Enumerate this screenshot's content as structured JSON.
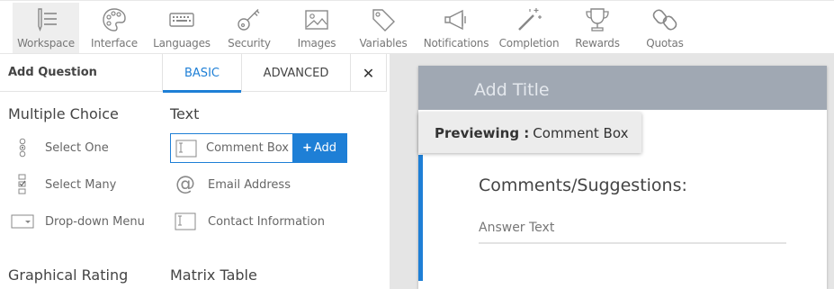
{
  "toolbar": {
    "items": [
      {
        "label": "Workspace",
        "icon": "workspace-icon",
        "active": true
      },
      {
        "label": "Interface",
        "icon": "palette-icon",
        "active": false
      },
      {
        "label": "Languages",
        "icon": "keyboard-icon",
        "active": false
      },
      {
        "label": "Security",
        "icon": "key-icon",
        "active": false
      },
      {
        "label": "Images",
        "icon": "image-icon",
        "active": false
      },
      {
        "label": "Variables",
        "icon": "tag-icon",
        "active": false
      },
      {
        "label": "Notifications",
        "icon": "megaphone-icon",
        "active": false
      },
      {
        "label": "Completion",
        "icon": "magic-wand-icon",
        "active": false
      },
      {
        "label": "Rewards",
        "icon": "trophy-icon",
        "active": false
      },
      {
        "label": "Quotas",
        "icon": "link-icon",
        "active": false
      }
    ]
  },
  "panel": {
    "title": "Add Question",
    "tabs": {
      "basic": "BASIC",
      "advanced": "ADVANCED"
    },
    "close_icon": "close-icon"
  },
  "sections": {
    "multiple_choice": {
      "title": "Multiple Choice",
      "items": [
        {
          "label": "Select One",
          "icon": "radio-list-icon"
        },
        {
          "label": "Select Many",
          "icon": "checkbox-list-icon"
        },
        {
          "label": "Drop-down Menu",
          "icon": "dropdown-icon"
        }
      ]
    },
    "text": {
      "title": "Text",
      "items": [
        {
          "label": "Comment Box",
          "icon": "text-box-icon"
        },
        {
          "label": "Email Address",
          "icon": "at-icon"
        },
        {
          "label": "Contact Information",
          "icon": "text-box-icon"
        }
      ],
      "add_button": "Add"
    },
    "graphical_rating": {
      "title": "Graphical Rating"
    },
    "matrix_table": {
      "title": "Matrix Table"
    }
  },
  "preview": {
    "add_title": "Add Title",
    "badge_key": "Previewing :",
    "badge_value": "Comment Box",
    "question": "Comments/Suggestions:",
    "answer_placeholder": "Answer Text"
  },
  "colors": {
    "accent": "#1e7fd6",
    "header": "#a0a8b3",
    "preview_bg": "#e5e5e5"
  }
}
